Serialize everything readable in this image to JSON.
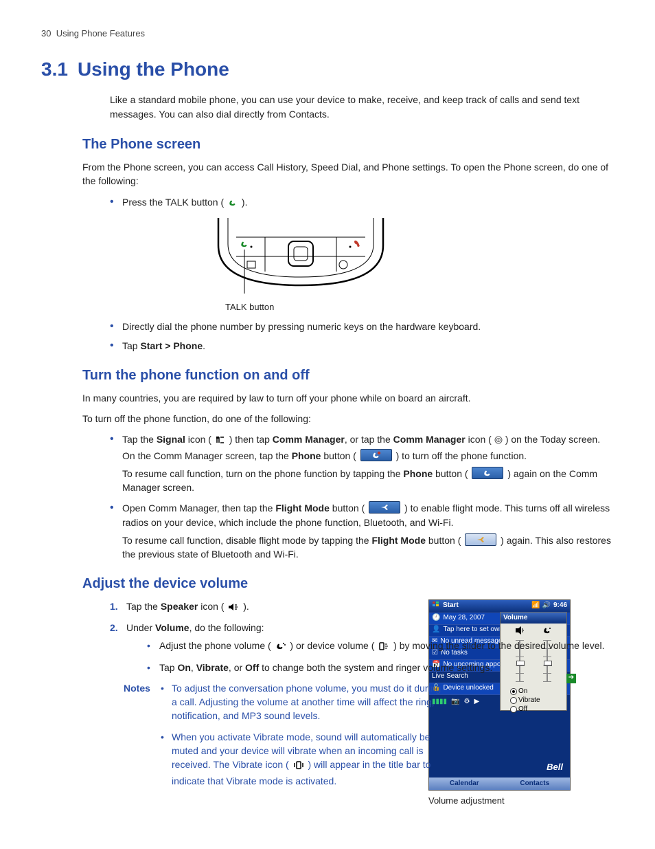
{
  "header": {
    "page_number": "30",
    "section": "Using Phone Features"
  },
  "title": {
    "number": "3.1",
    "text": "Using the Phone"
  },
  "intro": "Like a standard mobile phone, you can use your device to make, receive, and keep track of calls and send text messages. You can also dial directly from Contacts.",
  "phone_screen": {
    "heading": "The Phone screen",
    "lead": "From the Phone screen, you can access Call History, Speed Dial, and Phone settings. To open the Phone screen, do one of the following:",
    "b1_pre": "Press the TALK button ( ",
    "b1_post": " ).",
    "talk_caption": "TALK button",
    "b2": "Directly dial the phone number by pressing numeric keys on the hardware keyboard.",
    "b3_pre": "Tap ",
    "b3_bold": "Start > Phone",
    "b3_post": "."
  },
  "turn_onoff": {
    "heading": "Turn the phone function on and off",
    "p1": "In many countries, you are required by law to turn off your phone while on board an aircraft.",
    "p2": "To turn off the phone function, do one of the following:",
    "b1": {
      "t1": "Tap the ",
      "signal_b": "Signal",
      "t2": " icon ( ",
      "t3": " ) then tap ",
      "cm_b": "Comm Manager",
      "t4": ", or tap the ",
      "cm2_b": "Comm Manager",
      "t5": " icon (",
      "t6": ") on the Today screen. On the Comm Manager screen, tap the ",
      "phone_b": "Phone",
      "t7": " button ( ",
      "t8": " ) to turn off the phone function.",
      "resume_pre": "To resume call function, turn on the phone function by tapping the ",
      "resume_phone_b": "Phone",
      "resume_mid": " button ( ",
      "resume_post": " ) again on the Comm Manager screen."
    },
    "b2": {
      "t1": "Open Comm Manager, then tap the ",
      "fm_b": "Flight Mode",
      "t2": " button ( ",
      "t3": " ) to enable flight mode. This turns off all wireless radios on your device, which include the phone function, Bluetooth, and Wi-Fi.",
      "resume_pre": "To resume call function, disable flight mode by tapping the ",
      "resume_fm_b": "Flight Mode",
      "resume_mid": " button ( ",
      "resume_post": " ) again. This also restores the previous state of Bluetooth and Wi-Fi."
    }
  },
  "volume": {
    "heading": "Adjust the device volume",
    "s1_pre": "Tap the ",
    "s1_b": "Speaker",
    "s1_mid": " icon ( ",
    "s1_post": " ).",
    "s2_pre": "Under ",
    "s2_b": "Volume",
    "s2_post": ", do the following:",
    "sb1_pre": "Adjust the phone volume ( ",
    "sb1_mid": " ) or device volume ( ",
    "sb1_post": " ) by moving the slider to the desired volume level.",
    "sb2_pre": "Tap ",
    "sb2_on": "On",
    "sb2_c1": ", ",
    "sb2_vib": "Vibrate",
    "sb2_c2": ", or ",
    "sb2_off": "Off",
    "sb2_post": " to change both the system and ringer volume settings.",
    "notes_label": "Notes",
    "note1": "To adjust the conversation phone volume, you must do it during a call. Adjusting the volume at another time will affect the ring, notification, and MP3 sound levels.",
    "note2_pre": "When you activate Vibrate mode, sound will automatically be muted and your device will vibrate when an incoming call is received. The Vibrate icon ( ",
    "note2_post": " ) will appear in the title bar to indicate that Vibrate mode is activated.",
    "screenshot": {
      "start": "Start",
      "clock": "9:46",
      "date": "May 28, 2007",
      "owner": "Tap here to set own",
      "msgs": "No unread messages",
      "tasks": "No tasks",
      "appts": "No upcoming appoint",
      "live": "Live Search",
      "unlocked": "Device unlocked",
      "sk_left": "Calendar",
      "sk_right": "Contacts",
      "logo": "Bell",
      "popup_title": "Volume",
      "opt_on": "On",
      "opt_vib": "Vibrate",
      "opt_off": "Off"
    },
    "caption": "Volume adjustment"
  }
}
